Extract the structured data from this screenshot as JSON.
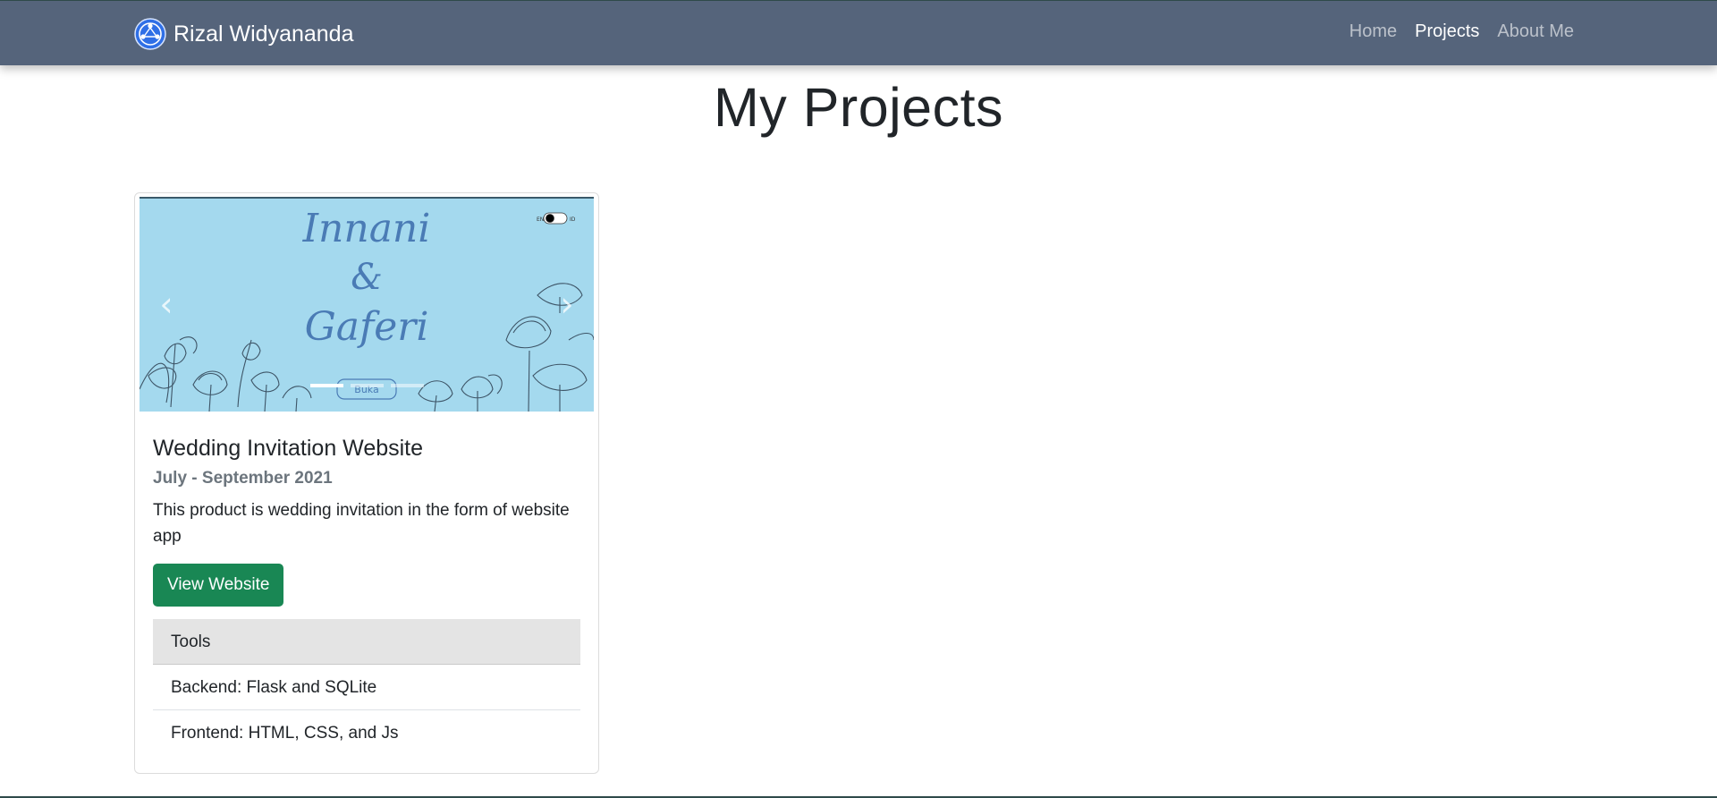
{
  "navbar": {
    "brand": "Rizal Widyananda",
    "links": [
      {
        "label": "Home",
        "active": false
      },
      {
        "label": "Projects",
        "active": true
      },
      {
        "label": "About Me",
        "active": false
      }
    ],
    "background_color": "#55647b"
  },
  "page": {
    "title": "My Projects"
  },
  "project_card": {
    "carousel": {
      "slide_text": [
        "Innani",
        "&",
        "Gaferi"
      ],
      "slide_button": "Buka",
      "toggle_labels": [
        "EN",
        "ID"
      ],
      "prev_icon": "chevron-left-icon",
      "next_icon": "chevron-right-icon",
      "indicator_count": 3,
      "active_indicator": 0,
      "background_color": "#a4d9ee"
    },
    "title": "Wedding Invitation Website",
    "subtitle": "July - September 2021",
    "description": "This product is wedding invitation in the form of website app",
    "button_label": "View Website",
    "button_color": "#198754",
    "tools": {
      "header": "Tools",
      "items": [
        "Backend: Flask and SQLite",
        "Frontend: HTML, CSS, and Js"
      ]
    }
  }
}
